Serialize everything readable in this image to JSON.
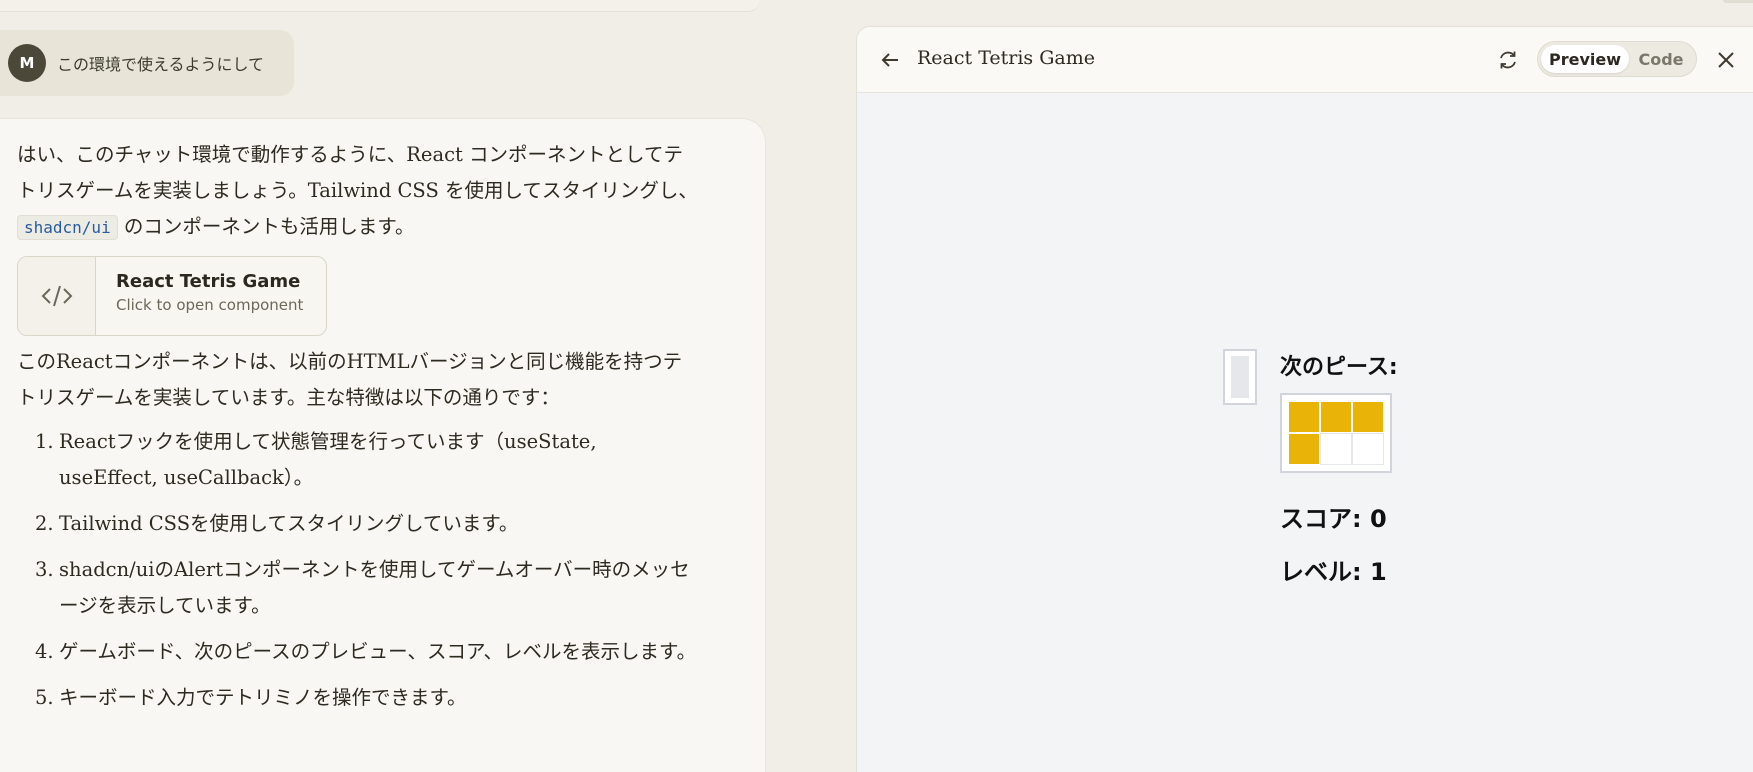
{
  "user_message": {
    "avatar_initial": "M",
    "text": "この環境で使えるようにして"
  },
  "assistant": {
    "intro_part1": "はい、このチャット環境で動作するように、React コンポーネントとしてテトリスゲームを実装しましょう。Tailwind CSS を使用してスタイリングし、",
    "intro_code": "shadcn/ui",
    "intro_part2": " のコンポーネントも活用します。",
    "artifact_card": {
      "icon": "code-icon",
      "title": "React Tetris Game",
      "subtitle": "Click to open component"
    },
    "summary": "このReactコンポーネントは、以前のHTMLバージョンと同じ機能を持つテトリスゲームを実装しています。主な特徴は以下の通りです：",
    "features": [
      {
        "num": "1.",
        "text": "Reactフックを使用して状態管理を行っています（useState, useEffect, useCallback）。"
      },
      {
        "num": "2.",
        "text": "Tailwind CSSを使用してスタイリングしています。"
      },
      {
        "num": "3.",
        "text": "shadcn/uiのAlertコンポーネントを使用してゲームオーバー時のメッセージを表示しています。"
      },
      {
        "num": "4.",
        "text": "ゲームボード、次のピースのプレビュー、スコア、レベルを表示します。"
      },
      {
        "num": "5.",
        "text": "キーボード入力でテトリミノを操作できます。"
      }
    ]
  },
  "panel": {
    "title": "React Tetris Game",
    "toggle": {
      "preview": "Preview",
      "code": "Code",
      "selected": "Preview"
    },
    "icons": {
      "back": "arrow-left-icon",
      "refresh": "refresh-icon",
      "close": "close-icon"
    }
  },
  "game": {
    "next_label": "次のピース:",
    "next_piece": [
      [
        1,
        1,
        1
      ],
      [
        1,
        0,
        0
      ]
    ],
    "piece_color": "#eab308",
    "score_text": "スコア: 0",
    "level_text": "レベル: 1"
  }
}
